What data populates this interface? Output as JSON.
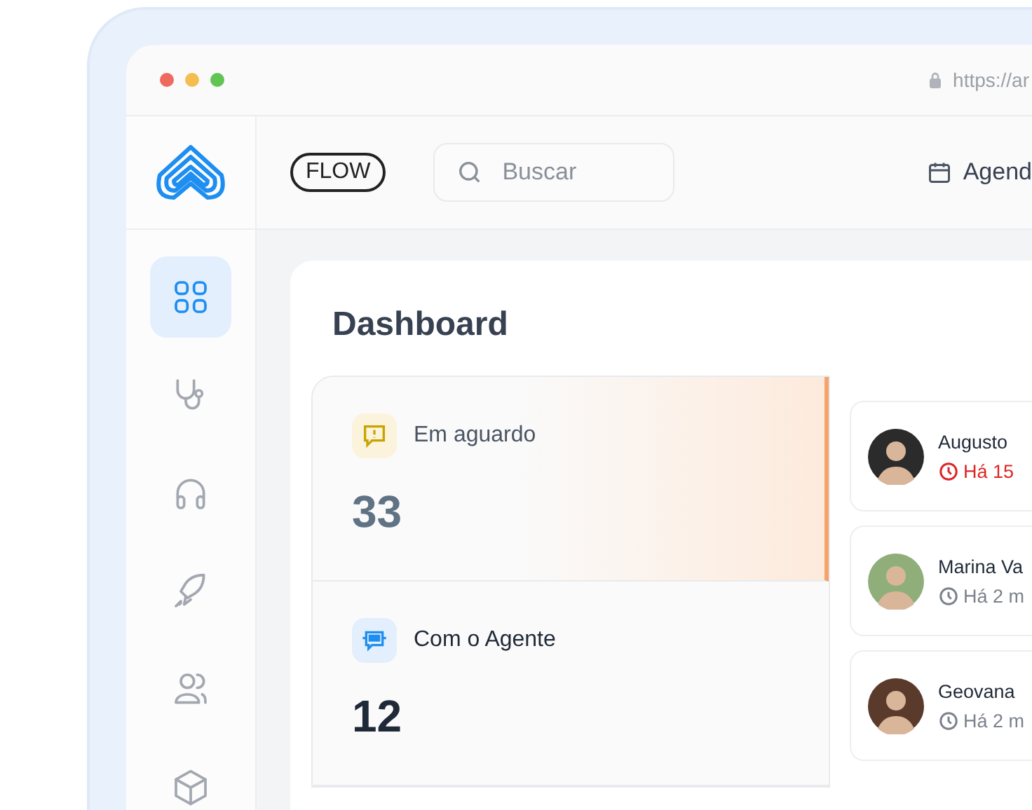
{
  "browser": {
    "url": "https://ar"
  },
  "header": {
    "badge": "FLOW",
    "search": {
      "placeholder": "Buscar"
    },
    "link": "Agend"
  },
  "sidebar": {
    "items": [
      {
        "selected": true
      },
      {
        "selected": false
      },
      {
        "selected": false
      },
      {
        "selected": false
      },
      {
        "selected": false
      },
      {
        "selected": false
      }
    ]
  },
  "page": {
    "title": "Dashboard"
  },
  "stats": [
    {
      "kind": "waiting",
      "label": "Em aguardo",
      "value": "33",
      "selected": true
    },
    {
      "kind": "agent",
      "label": "Com o Agente",
      "value": "12",
      "selected": false
    }
  ],
  "queue": [
    {
      "name": "Augusto",
      "time": "Há 15",
      "urgent": true
    },
    {
      "name": "Marina Va",
      "time": "Há 2 m",
      "urgent": false
    },
    {
      "name": "Geovana",
      "time": "Há 2 m",
      "urgent": false
    }
  ]
}
